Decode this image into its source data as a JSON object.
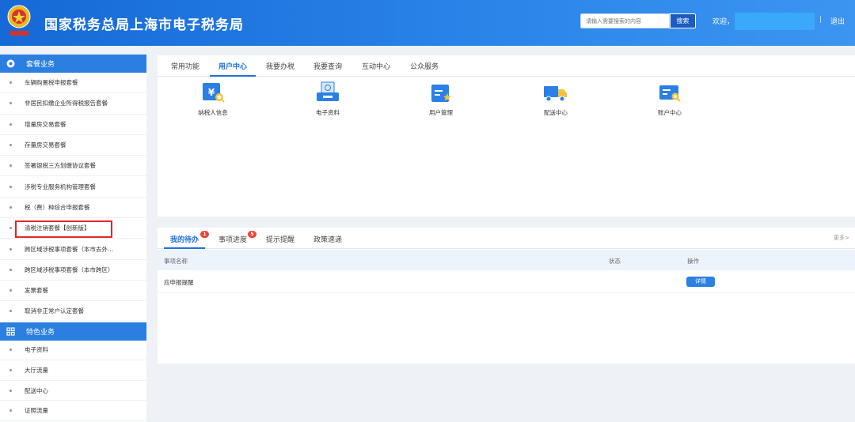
{
  "header": {
    "site_title": "国家税务总局上海市电子税务局",
    "search_placeholder": "请输入需要搜索的内容",
    "search_button": "搜索",
    "welcome": "欢迎，",
    "separator": "|",
    "logout": "退出"
  },
  "sidebar": {
    "section1": {
      "title": "套餐业务",
      "items": [
        "车辆购置税申报套餐",
        "非居民扣缴企业所得税报告套餐",
        "增量房交易套餐",
        "存量房交易套餐",
        "签署银税三方划缴协议套餐",
        "涉税专业服务机构管理套餐",
        "税（费）种综合申报套餐",
        "清税注销套餐【创新版】",
        "跨区域涉税事项套餐（本市去外...",
        "跨区域涉税事项套餐（本市跨区）",
        "发票套餐",
        "取消非正常户认定套餐"
      ]
    },
    "section2": {
      "title": "特色业务",
      "items": [
        "电子资料",
        "大厅流量",
        "配送中心",
        "证照流量"
      ]
    }
  },
  "main": {
    "tabs": [
      "常用功能",
      "用户中心",
      "我要办税",
      "我要查询",
      "互动中心",
      "公众服务"
    ],
    "tiles": [
      {
        "label": "纳税人信息",
        "icon": "taxpayer-info-icon"
      },
      {
        "label": "电子资料",
        "icon": "electronic-data-icon"
      },
      {
        "label": "用户管理",
        "icon": "user-management-icon"
      },
      {
        "label": "配送中心",
        "icon": "delivery-truck-icon"
      },
      {
        "label": "账户中心",
        "icon": "account-center-icon"
      }
    ]
  },
  "todo": {
    "tabs": [
      "我的待办",
      "事项进度",
      "提示提醒",
      "政策速递"
    ],
    "badges": [
      "1",
      "5"
    ],
    "more": "更多>",
    "columns": [
      "事项名称",
      "状态",
      "操作"
    ],
    "rows": [
      {
        "name": "应申报提醒",
        "status": "",
        "action": "详情"
      }
    ]
  },
  "colors": {
    "header": "#1f77e0",
    "accent": "#1f70dd",
    "highlight_box": "#e0262a",
    "badge": "#e9453a"
  }
}
